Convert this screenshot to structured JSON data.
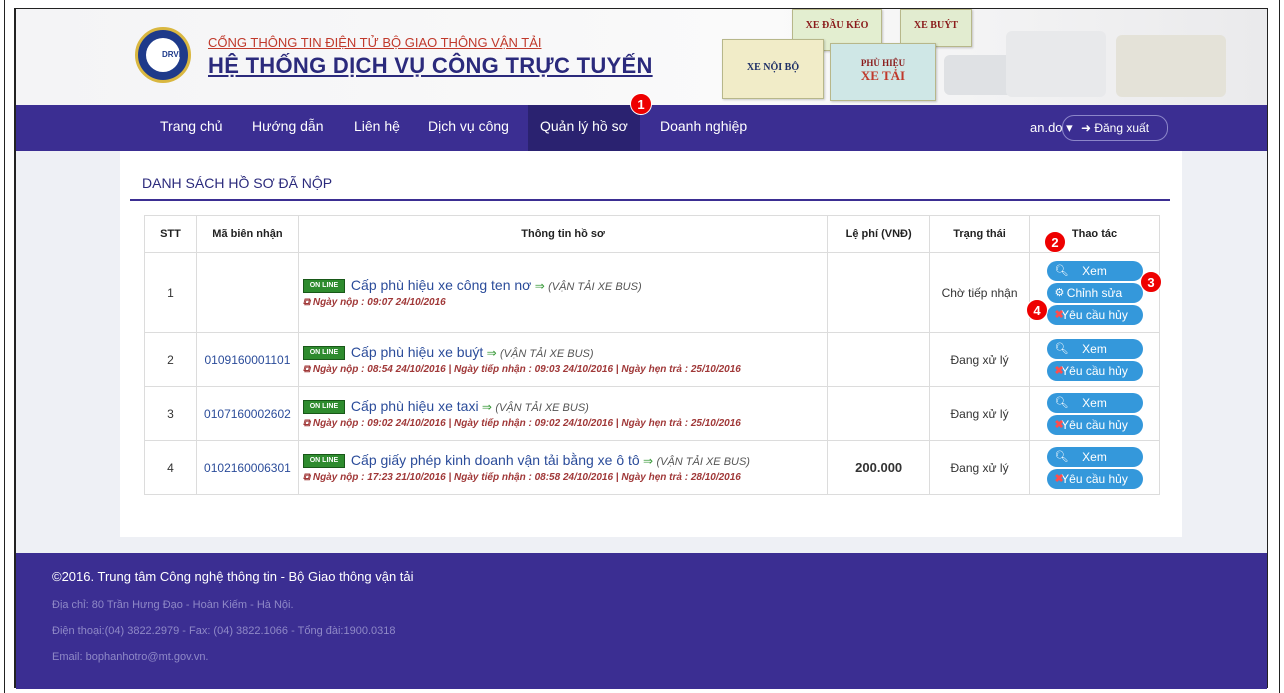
{
  "header": {
    "portal_title": "CỔNG THÔNG TIN ĐIỆN TỬ BỘ GIAO THÔNG VẬN TẢI",
    "system_title": "HỆ THỐNG DỊCH VỤ CÔNG TRỰC TUYẾN",
    "logo_text": "DRVN",
    "cards": {
      "noi_bo": "XE NỘI BỘ",
      "dau_keo": "XE ĐẦU KÉO",
      "phu_hieu": "PHÙ HIỆU",
      "xe_tai": "XE TẢI",
      "buyt": "XE BUÝT"
    }
  },
  "nav": {
    "items": [
      "Trang chủ",
      "Hướng dẫn",
      "Liên hệ",
      "Dịch vụ công",
      "Quản lý hồ sơ",
      "Doanh nghiệp"
    ],
    "active": "Quản lý hồ sơ",
    "user": "an.do ▾",
    "logout": "Đăng xuất"
  },
  "badges": [
    "1",
    "2",
    "3",
    "4"
  ],
  "panel": {
    "title": "DANH SÁCH HỒ SƠ ĐÃ NỘP",
    "columns": [
      "STT",
      "Mã biên nhận",
      "Thông tin hồ sơ",
      "Lệ phí (VNĐ)",
      "Trạng thái",
      "Thao tác"
    ],
    "rows": [
      {
        "stt": "1",
        "code": "",
        "service": "Cấp phù hiệu xe công ten nơ",
        "category": "(VẬN TẢI XE BUS)",
        "dates": "Ngày nộp : 09:07 24/10/2016",
        "fee": "",
        "status": "Chờ tiếp nhận",
        "actions": [
          "Xem",
          "Chỉnh sửa",
          "Yêu cầu hủy"
        ]
      },
      {
        "stt": "2",
        "code": "0109160001101",
        "service": "Cấp phù hiệu xe buýt",
        "category": "(VẬN TẢI XE BUS)",
        "dates": "Ngày nộp : 08:54 24/10/2016 | Ngày tiếp nhận : 09:03 24/10/2016 | Ngày hẹn trả : 25/10/2016",
        "fee": "",
        "status": "Đang xử lý",
        "actions": [
          "Xem",
          "Yêu cầu hủy"
        ]
      },
      {
        "stt": "3",
        "code": "0107160002602",
        "service": "Cấp phù hiệu xe taxi",
        "category": "(VẬN TẢI XE BUS)",
        "dates": "Ngày nộp : 09:02 24/10/2016 | Ngày tiếp nhận : 09:02 24/10/2016 | Ngày hẹn trả : 25/10/2016",
        "fee": "",
        "status": "Đang xử lý",
        "actions": [
          "Xem",
          "Yêu cầu hủy"
        ]
      },
      {
        "stt": "4",
        "code": "0102160006301",
        "service": "Cấp giấy phép kinh doanh vận tải bằng xe ô tô",
        "category": "(VẬN TẢI XE BUS)",
        "dates": "Ngày nộp : 17:23 21/10/2016 | Ngày tiếp nhận : 08:58 24/10/2016 | Ngày hẹn trả : 28/10/2016",
        "fee": "200.000",
        "status": "Đang xử lý",
        "actions": [
          "Xem",
          "Yêu cầu hủy"
        ]
      }
    ],
    "online_label": "ON LINE",
    "arrow": "⇒"
  },
  "footer": {
    "copyright": "©2016. Trung tâm Công nghệ thông tin - Bộ Giao thông vận tải",
    "address": "Địa chỉ: 80 Trần Hưng Đạo - Hoàn Kiếm - Hà Nội.",
    "phone": "Điện thoại:(04) 3822.2979 - Fax: (04) 3822.1066 - Tổng đài:1900.0318",
    "email": "Email: bophanhotro@mt.gov.vn."
  }
}
